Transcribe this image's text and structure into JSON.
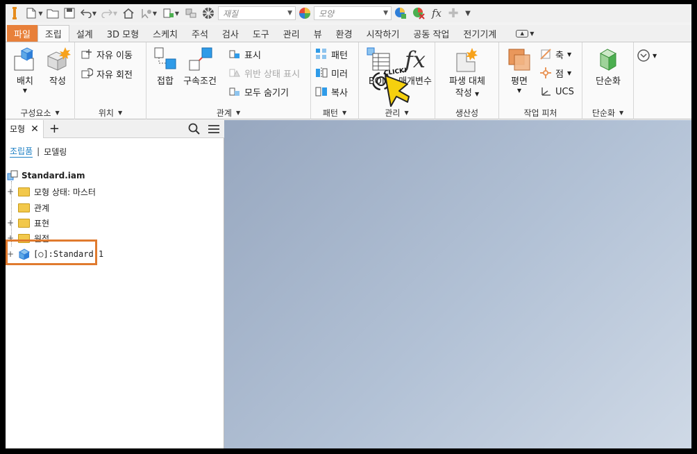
{
  "quick_access": {
    "material_placeholder": "재질",
    "appearance_placeholder": "모양",
    "fx_label": "fx"
  },
  "tabs": [
    "파일",
    "조립",
    "설계",
    "3D 모형",
    "스케치",
    "주석",
    "검사",
    "도구",
    "관리",
    "뷰",
    "환경",
    "시작하기",
    "공동 작업",
    "전기기계"
  ],
  "active_tab": "조립",
  "ribbon": {
    "component": {
      "place": "배치",
      "create": "작성",
      "footer": "구성요소"
    },
    "position": {
      "free_move": "자유 이동",
      "free_rotate": "자유 회전",
      "footer": "위치"
    },
    "relationships": {
      "joint": "접합",
      "constrain": "구속조건",
      "show": "표시",
      "show_sick": "위반 상태 표시",
      "hide_all": "모두 숨기기",
      "footer": "관계"
    },
    "pattern": {
      "pattern": "패턴",
      "mirror": "미러",
      "copy": "복사",
      "footer": "패턴"
    },
    "manage": {
      "bom": "BOM",
      "params": "매개변수",
      "click": "CLICK!",
      "footer": "관리"
    },
    "productivity": {
      "substitute_1": "파생 대체",
      "substitute_2": "작성",
      "footer": "생산성"
    },
    "work_features": {
      "plane": "평면",
      "axis": "축",
      "point": "점",
      "ucs": "UCS",
      "footer": "작업 피처"
    },
    "simplification": {
      "simplify": "단순화",
      "footer": "단순화"
    }
  },
  "browser": {
    "tab_label": "모형",
    "view_assembly": "조립품",
    "view_modeling": "모델링",
    "root": "Standard.iam",
    "nodes": [
      "모형 상태: 마스터",
      "관계",
      "표현",
      "원점",
      "[○]:Standard:1"
    ]
  },
  "colors": {
    "file_tab": "#e8803a",
    "highlight": "#e07a2e",
    "viewport_start": "#97a7bf",
    "viewport_end": "#cfd9e6"
  }
}
